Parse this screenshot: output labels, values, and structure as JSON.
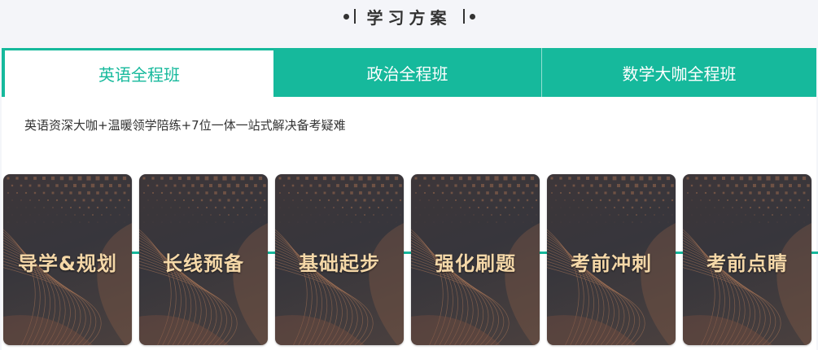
{
  "header": {
    "title": "学习方案"
  },
  "tabs": [
    {
      "label": "英语全程班",
      "active": true
    },
    {
      "label": "政治全程班",
      "active": false
    },
    {
      "label": "数学大咖全程班",
      "active": false
    }
  ],
  "description": "英语资深大咖+温暖领学陪练+7位一体一站式解决备考疑难",
  "stages": [
    {
      "label": "导学&规划"
    },
    {
      "label": "长线预备"
    },
    {
      "label": "基础起步"
    },
    {
      "label": "强化刷题"
    },
    {
      "label": "考前冲刺"
    },
    {
      "label": "考前点睛"
    }
  ],
  "colors": {
    "accent": "#16b99c",
    "card_text": "#f5d8a8",
    "card_bg": "#3a3539"
  }
}
